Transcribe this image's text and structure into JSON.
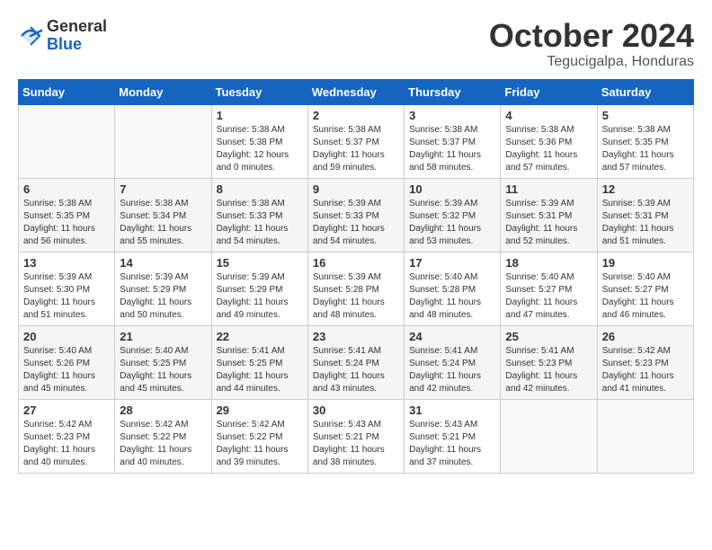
{
  "logo": {
    "general": "General",
    "blue": "Blue"
  },
  "title": "October 2024",
  "subtitle": "Tegucigalpa, Honduras",
  "days_header": [
    "Sunday",
    "Monday",
    "Tuesday",
    "Wednesday",
    "Thursday",
    "Friday",
    "Saturday"
  ],
  "weeks": [
    [
      {
        "day": "",
        "info": ""
      },
      {
        "day": "",
        "info": ""
      },
      {
        "day": "1",
        "info": "Sunrise: 5:38 AM\nSunset: 5:38 PM\nDaylight: 12 hours\nand 0 minutes."
      },
      {
        "day": "2",
        "info": "Sunrise: 5:38 AM\nSunset: 5:37 PM\nDaylight: 11 hours\nand 59 minutes."
      },
      {
        "day": "3",
        "info": "Sunrise: 5:38 AM\nSunset: 5:37 PM\nDaylight: 11 hours\nand 58 minutes."
      },
      {
        "day": "4",
        "info": "Sunrise: 5:38 AM\nSunset: 5:36 PM\nDaylight: 11 hours\nand 57 minutes."
      },
      {
        "day": "5",
        "info": "Sunrise: 5:38 AM\nSunset: 5:35 PM\nDaylight: 11 hours\nand 57 minutes."
      }
    ],
    [
      {
        "day": "6",
        "info": "Sunrise: 5:38 AM\nSunset: 5:35 PM\nDaylight: 11 hours\nand 56 minutes."
      },
      {
        "day": "7",
        "info": "Sunrise: 5:38 AM\nSunset: 5:34 PM\nDaylight: 11 hours\nand 55 minutes."
      },
      {
        "day": "8",
        "info": "Sunrise: 5:38 AM\nSunset: 5:33 PM\nDaylight: 11 hours\nand 54 minutes."
      },
      {
        "day": "9",
        "info": "Sunrise: 5:39 AM\nSunset: 5:33 PM\nDaylight: 11 hours\nand 54 minutes."
      },
      {
        "day": "10",
        "info": "Sunrise: 5:39 AM\nSunset: 5:32 PM\nDaylight: 11 hours\nand 53 minutes."
      },
      {
        "day": "11",
        "info": "Sunrise: 5:39 AM\nSunset: 5:31 PM\nDaylight: 11 hours\nand 52 minutes."
      },
      {
        "day": "12",
        "info": "Sunrise: 5:39 AM\nSunset: 5:31 PM\nDaylight: 11 hours\nand 51 minutes."
      }
    ],
    [
      {
        "day": "13",
        "info": "Sunrise: 5:39 AM\nSunset: 5:30 PM\nDaylight: 11 hours\nand 51 minutes."
      },
      {
        "day": "14",
        "info": "Sunrise: 5:39 AM\nSunset: 5:29 PM\nDaylight: 11 hours\nand 50 minutes."
      },
      {
        "day": "15",
        "info": "Sunrise: 5:39 AM\nSunset: 5:29 PM\nDaylight: 11 hours\nand 49 minutes."
      },
      {
        "day": "16",
        "info": "Sunrise: 5:39 AM\nSunset: 5:28 PM\nDaylight: 11 hours\nand 48 minutes."
      },
      {
        "day": "17",
        "info": "Sunrise: 5:40 AM\nSunset: 5:28 PM\nDaylight: 11 hours\nand 48 minutes."
      },
      {
        "day": "18",
        "info": "Sunrise: 5:40 AM\nSunset: 5:27 PM\nDaylight: 11 hours\nand 47 minutes."
      },
      {
        "day": "19",
        "info": "Sunrise: 5:40 AM\nSunset: 5:27 PM\nDaylight: 11 hours\nand 46 minutes."
      }
    ],
    [
      {
        "day": "20",
        "info": "Sunrise: 5:40 AM\nSunset: 5:26 PM\nDaylight: 11 hours\nand 45 minutes."
      },
      {
        "day": "21",
        "info": "Sunrise: 5:40 AM\nSunset: 5:25 PM\nDaylight: 11 hours\nand 45 minutes."
      },
      {
        "day": "22",
        "info": "Sunrise: 5:41 AM\nSunset: 5:25 PM\nDaylight: 11 hours\nand 44 minutes."
      },
      {
        "day": "23",
        "info": "Sunrise: 5:41 AM\nSunset: 5:24 PM\nDaylight: 11 hours\nand 43 minutes."
      },
      {
        "day": "24",
        "info": "Sunrise: 5:41 AM\nSunset: 5:24 PM\nDaylight: 11 hours\nand 42 minutes."
      },
      {
        "day": "25",
        "info": "Sunrise: 5:41 AM\nSunset: 5:23 PM\nDaylight: 11 hours\nand 42 minutes."
      },
      {
        "day": "26",
        "info": "Sunrise: 5:42 AM\nSunset: 5:23 PM\nDaylight: 11 hours\nand 41 minutes."
      }
    ],
    [
      {
        "day": "27",
        "info": "Sunrise: 5:42 AM\nSunset: 5:23 PM\nDaylight: 11 hours\nand 40 minutes."
      },
      {
        "day": "28",
        "info": "Sunrise: 5:42 AM\nSunset: 5:22 PM\nDaylight: 11 hours\nand 40 minutes."
      },
      {
        "day": "29",
        "info": "Sunrise: 5:42 AM\nSunset: 5:22 PM\nDaylight: 11 hours\nand 39 minutes."
      },
      {
        "day": "30",
        "info": "Sunrise: 5:43 AM\nSunset: 5:21 PM\nDaylight: 11 hours\nand 38 minutes."
      },
      {
        "day": "31",
        "info": "Sunrise: 5:43 AM\nSunset: 5:21 PM\nDaylight: 11 hours\nand 37 minutes."
      },
      {
        "day": "",
        "info": ""
      },
      {
        "day": "",
        "info": ""
      }
    ]
  ]
}
